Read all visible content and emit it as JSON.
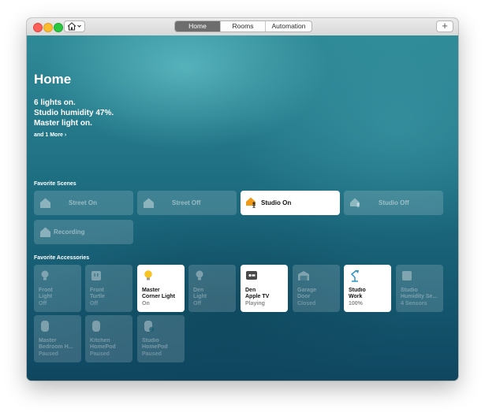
{
  "window": {
    "tabs": [
      {
        "label": "Home",
        "active": true
      },
      {
        "label": "Rooms",
        "active": false
      },
      {
        "label": "Automation",
        "active": false
      }
    ],
    "add_label": "+",
    "home_menu_icon": "house-icon"
  },
  "header": {
    "title": "Home",
    "status": [
      "6 lights on.",
      "Studio humidity 47%.",
      "Master light on."
    ],
    "more_link": "and 1 More ›"
  },
  "favorite_scenes": {
    "label": "Favorite Scenes",
    "items": [
      {
        "label": "Street On",
        "on": false,
        "icon": "house-icon"
      },
      {
        "label": "Street Off",
        "on": false,
        "icon": "house-icon"
      },
      {
        "label": "Studio On",
        "on": true,
        "icon": "house-person-icon"
      },
      {
        "label": "Studio Off",
        "on": false,
        "icon": "house-person-icon"
      },
      {
        "label": "Recording",
        "on": false,
        "icon": "house-icon"
      }
    ]
  },
  "favorite_accessories": {
    "label": "Favorite Accessories",
    "items": [
      {
        "name": "Front\nLight",
        "status": "Off",
        "on": false,
        "icon": "bulb-icon"
      },
      {
        "name": "Front\nTurtle",
        "status": "Off",
        "on": false,
        "icon": "outlet-icon"
      },
      {
        "name": "Master\nCorner Light",
        "status": "On",
        "on": true,
        "icon": "bulb-icon"
      },
      {
        "name": "Den\nLight",
        "status": "Off",
        "on": false,
        "icon": "bulb-icon"
      },
      {
        "name": "Den\nApple TV",
        "status": "Playing",
        "on": true,
        "icon": "appletv-icon"
      },
      {
        "name": "Garage\nDoor",
        "status": "Closed",
        "on": false,
        "icon": "garage-icon"
      },
      {
        "name": "Studio\nWork",
        "status": "100%",
        "on": true,
        "icon": "desk-lamp-icon"
      },
      {
        "name": "Studio\nHumidity Se...",
        "status": "4 Sensors",
        "on": false,
        "icon": "sensor-icon"
      },
      {
        "name": "Master\nBedroom H...",
        "status": "Paused",
        "on": false,
        "icon": "homepod-icon"
      },
      {
        "name": "Kitchen\nHomePod",
        "status": "Paused",
        "on": false,
        "icon": "homepod-icon"
      },
      {
        "name": "Studio\nHomePod",
        "status": "Paused",
        "on": false,
        "icon": "homepod-icon"
      }
    ]
  },
  "colors": {
    "accent_yellow": "#f7c325",
    "accent_orange": "#f09a1a",
    "lamp_blue": "#2d93c9",
    "active_tab": "#6d6d6d"
  }
}
